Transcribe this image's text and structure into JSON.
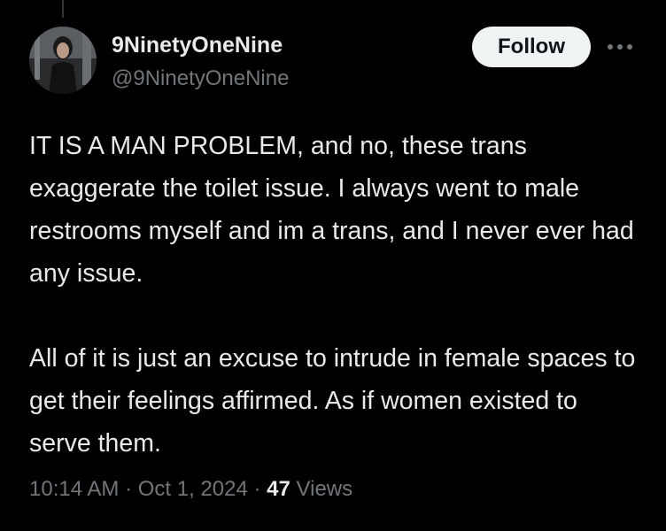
{
  "author": {
    "display_name": "9NinetyOneNine",
    "handle": "@9NinetyOneNine"
  },
  "follow_button": {
    "label": "Follow"
  },
  "more_options": {
    "icon": "more-horizontal-icon"
  },
  "tweet": {
    "paragraphs": [
      "IT IS A MAN PROBLEM, and no, these trans exaggerate the toilet issue. I always went to male restrooms myself and im a trans, and I never ever had any issue.",
      "All of it is just an excuse to intrude in female spaces to get their feelings affirmed. As if women existed to serve them."
    ],
    "time": "10:14 AM",
    "separator_1": "·",
    "date": "Oct 1, 2024",
    "separator_2": "·",
    "views_count": "47",
    "views_label": "Views"
  },
  "colors": {
    "background": "#000000",
    "primary_text": "#e7e9ea",
    "secondary_text": "#71767b",
    "follow_button_bg": "#eff3f4",
    "follow_button_text": "#0f1419"
  }
}
